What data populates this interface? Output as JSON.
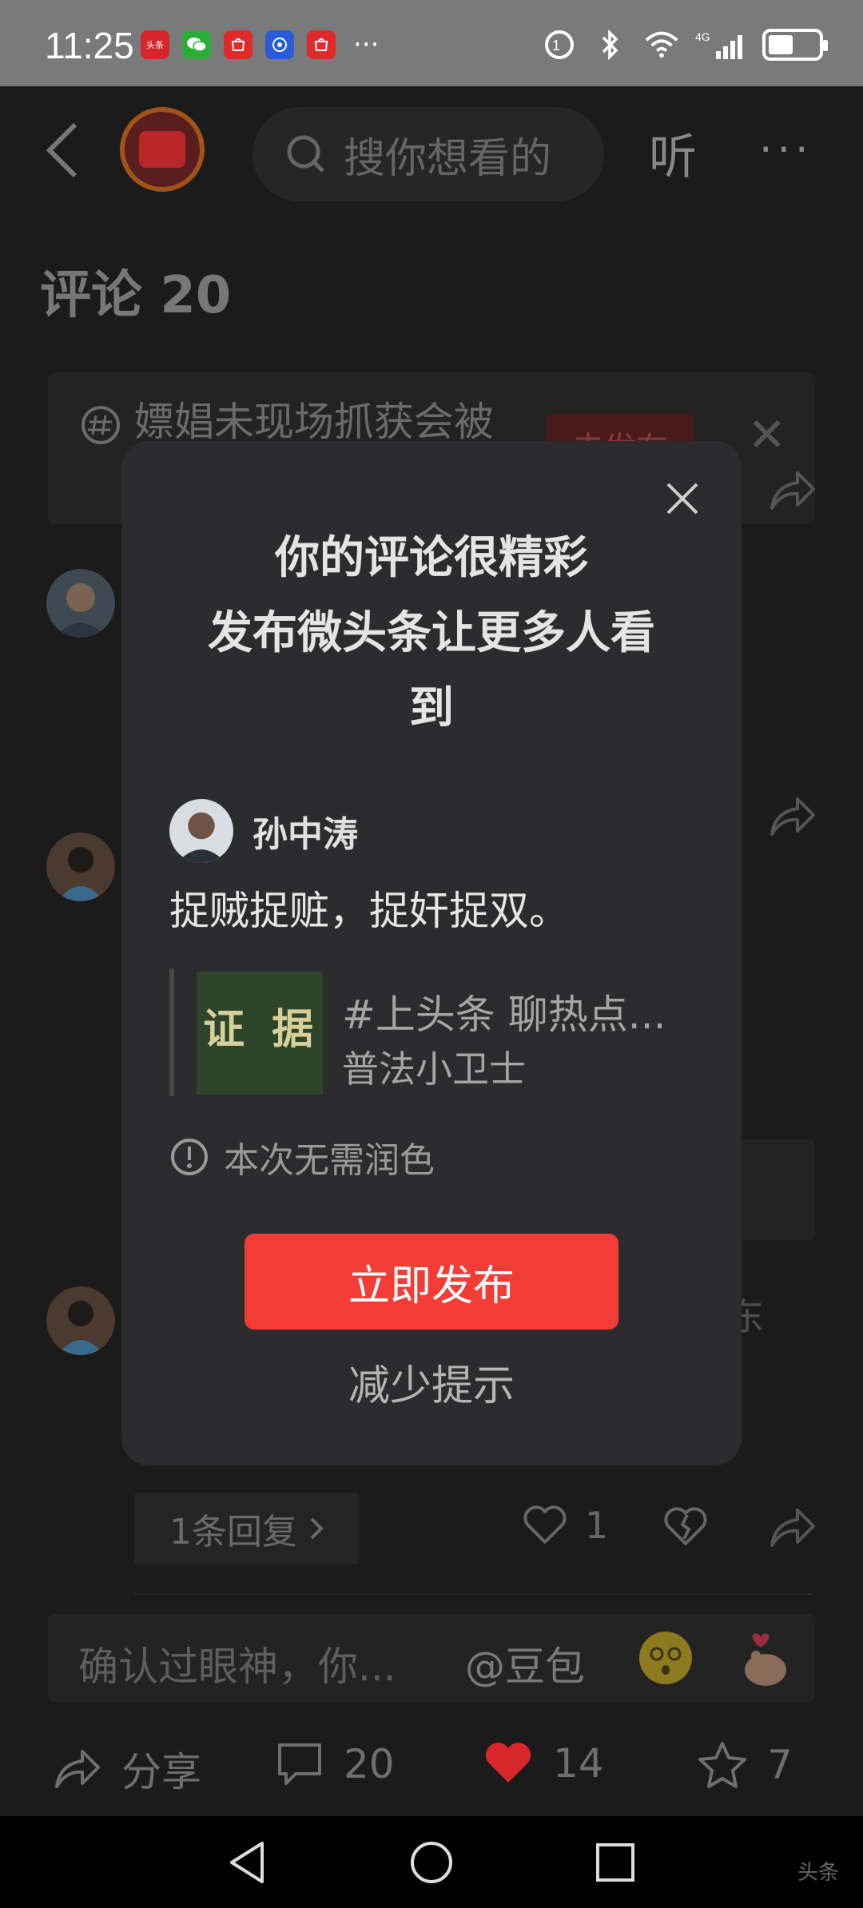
{
  "status": {
    "time": "11:25",
    "app_icons": [
      "toutiao-icon",
      "wechat-icon",
      "huawei-store-icon",
      "baidu-icon",
      "huawei-store-icon"
    ],
    "more": "···",
    "network": "4G"
  },
  "header": {
    "search_placeholder": "搜你想看的",
    "listen_label": "听",
    "more": "···"
  },
  "comments": {
    "title": "评论 20"
  },
  "topic": {
    "text": "嫖娼未现场抓获会被",
    "publish_label": "去发布"
  },
  "dialog": {
    "title_line1": "你的评论很精彩",
    "title_line2": "发布微头条让更多人看",
    "title_line3": "到",
    "user_name": "孙中涛",
    "comment": "捉贼捉赃，捉奸捉双。",
    "quote_thumb_text": "证 据",
    "quote_title": "#上头条 聊热点...",
    "quote_author": "普法小卫士",
    "notice": "本次无需润色",
    "publish_button": "立即发布",
    "reduce_label": "减少提示"
  },
  "bg_comment": {
    "partial_text": "东",
    "reply_chip": "1条回复",
    "like_count": "1"
  },
  "input": {
    "placeholder": "确认过眼神，你...",
    "mention": "@豆包"
  },
  "actions": {
    "share": "分享",
    "comment_count": "20",
    "like_count": "14",
    "fav_count": "7"
  },
  "colors": {
    "accent": "#f33c36",
    "like_red": "#d8272b",
    "dialog_bg": "#2c2c2e"
  },
  "watermark": "头条"
}
